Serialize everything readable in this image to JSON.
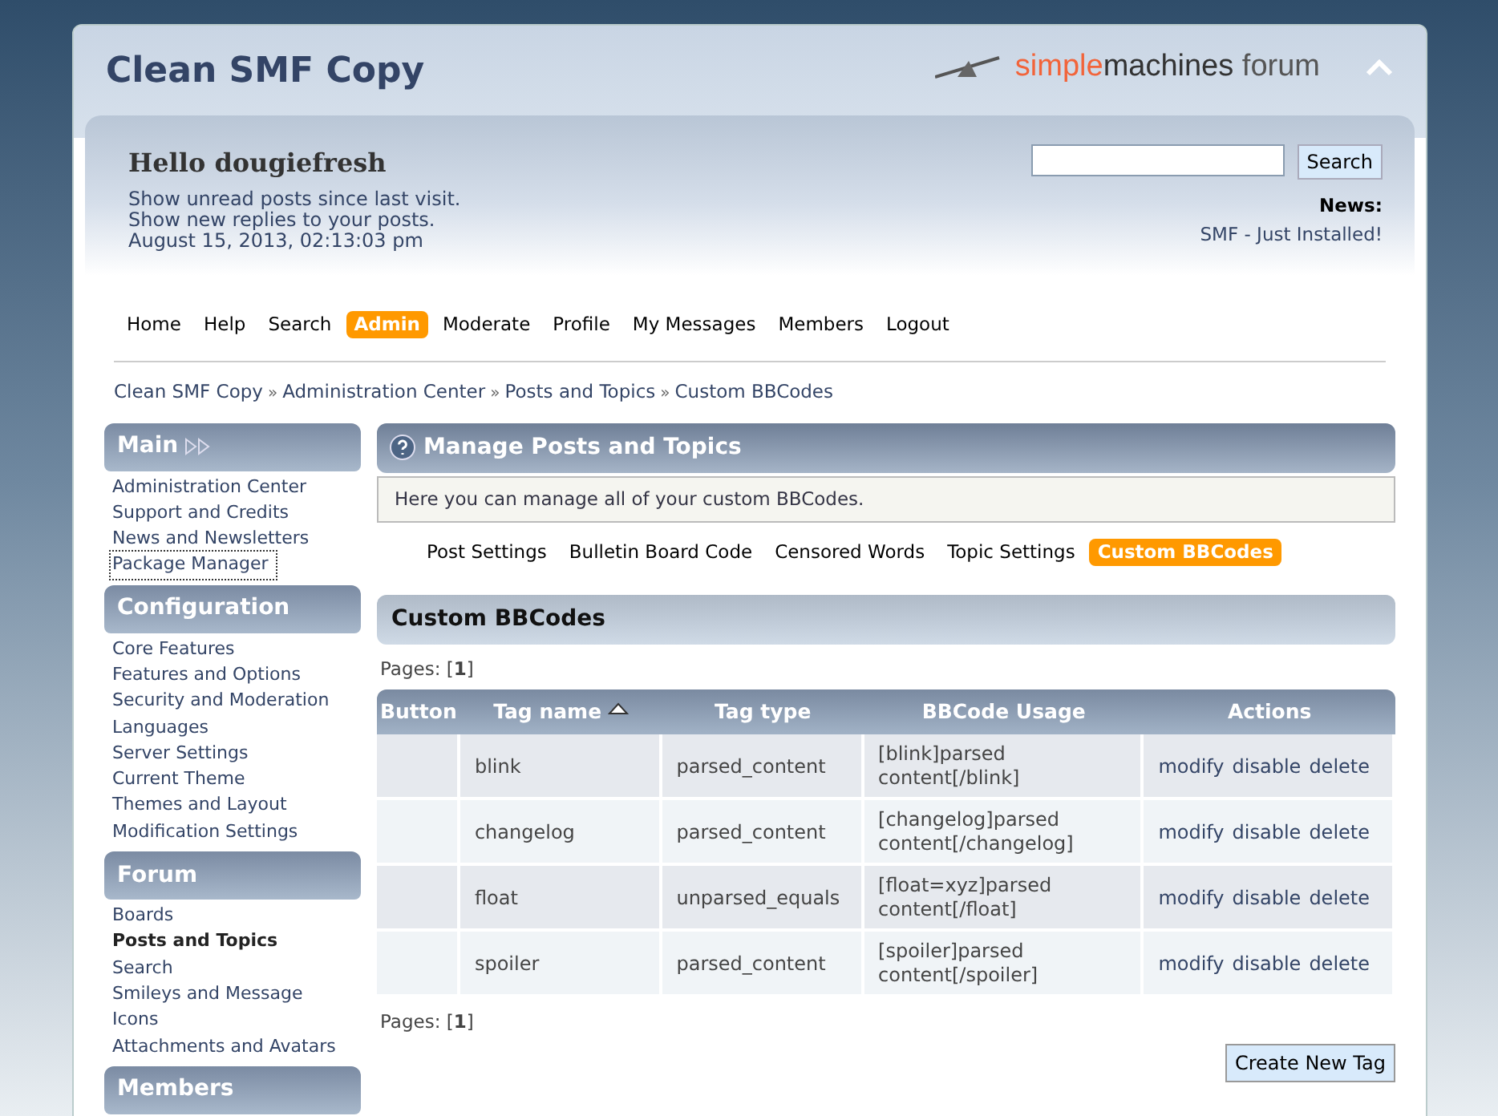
{
  "forum_title": "Clean SMF Copy",
  "logo": {
    "part_1": "simple",
    "part_2": "machines",
    "part_3": "forum"
  },
  "user": {
    "greeting": "Hello dougiefresh",
    "links": [
      "Show unread posts since last visit.",
      "Show new replies to your posts."
    ],
    "date": "August 15, 2013, 02:13:03 pm"
  },
  "search": {
    "button": "Search"
  },
  "news": {
    "label": "News:",
    "text": "SMF - Just Installed!"
  },
  "menu": [
    {
      "label": "Home",
      "selected": false
    },
    {
      "label": "Help",
      "selected": false
    },
    {
      "label": "Search",
      "selected": false
    },
    {
      "label": "Admin",
      "selected": true
    },
    {
      "label": "Moderate",
      "selected": false
    },
    {
      "label": "Profile",
      "selected": false
    },
    {
      "label": "My Messages",
      "selected": false
    },
    {
      "label": "Members",
      "selected": false
    },
    {
      "label": "Logout",
      "selected": false
    }
  ],
  "breadcrumb": [
    "Clean SMF Copy",
    "Administration Center",
    "Posts and Topics",
    "Custom BBCodes"
  ],
  "breadcrumb_separator": "»",
  "sidebar": [
    {
      "title": "Main",
      "collapsible": true,
      "items": [
        {
          "label": "Administration Center",
          "selected": false,
          "focused": false
        },
        {
          "label": "Support and Credits",
          "selected": false,
          "focused": false
        },
        {
          "label": "News and Newsletters",
          "selected": false,
          "focused": false
        },
        {
          "label": "Package Manager",
          "selected": false,
          "focused": true
        }
      ]
    },
    {
      "title": "Configuration",
      "collapsible": false,
      "items": [
        {
          "label": "Core Features",
          "selected": false,
          "focused": false
        },
        {
          "label": "Features and Options",
          "selected": false,
          "focused": false
        },
        {
          "label": "Security and Moderation",
          "selected": false,
          "focused": false
        },
        {
          "label": "Languages",
          "selected": false,
          "focused": false
        },
        {
          "label": "Server Settings",
          "selected": false,
          "focused": false
        },
        {
          "label": "Current Theme",
          "selected": false,
          "focused": false
        },
        {
          "label": "Themes and Layout",
          "selected": false,
          "focused": false
        },
        {
          "label": "Modification Settings",
          "selected": false,
          "focused": false
        }
      ]
    },
    {
      "title": "Forum",
      "collapsible": false,
      "items": [
        {
          "label": "Boards",
          "selected": false,
          "focused": false
        },
        {
          "label": "Posts and Topics",
          "selected": true,
          "focused": false
        },
        {
          "label": "Search",
          "selected": false,
          "focused": false
        },
        {
          "label": "Smileys and Message Icons",
          "selected": false,
          "focused": false
        },
        {
          "label": "Attachments and Avatars",
          "selected": false,
          "focused": false
        }
      ]
    },
    {
      "title": "Members",
      "collapsible": false
    }
  ],
  "panel": {
    "title": "Manage Posts and Topics",
    "description": "Here you can manage all of your custom BBCodes.",
    "tabs": [
      {
        "label": "Post Settings",
        "selected": false
      },
      {
        "label": "Bulletin Board Code",
        "selected": false
      },
      {
        "label": "Censored Words",
        "selected": false
      },
      {
        "label": "Topic Settings",
        "selected": false
      },
      {
        "label": "Custom BBCodes",
        "selected": true
      }
    ]
  },
  "section_title": "Custom BBCodes",
  "pages_top": "Pages: [**1**]",
  "table": {
    "columns": [
      {
        "label": "Button",
        "sorted": false
      },
      {
        "label": "Tag name",
        "sorted": true
      },
      {
        "label": "Tag type",
        "sorted": false
      },
      {
        "label": "BBCode Usage",
        "sorted": false
      },
      {
        "label": "Actions",
        "sorted": false
      }
    ],
    "rows": [
      {
        "tag_name": "blink",
        "tag_type": "parsed_content",
        "usage": "[blink]parsed content[/blink]",
        "actions": [
          "modify",
          "disable",
          "delete"
        ]
      },
      {
        "tag_name": "changelog",
        "tag_type": "parsed_content",
        "usage": "[changelog]parsed content[/changelog]",
        "actions": [
          "modify",
          "disable",
          "delete"
        ]
      },
      {
        "tag_name": "float",
        "tag_type": "unparsed_equals",
        "usage": "[float=xyz]parsed content[/float]",
        "actions": [
          "modify",
          "disable",
          "delete"
        ]
      },
      {
        "tag_name": "spoiler",
        "tag_type": "parsed_content",
        "usage": "[spoiler]parsed content[/spoiler]",
        "actions": [
          "modify",
          "disable",
          "delete"
        ]
      }
    ]
  },
  "pages_bottom": "Pages: [**1**]",
  "create_button": "Create New Tag"
}
